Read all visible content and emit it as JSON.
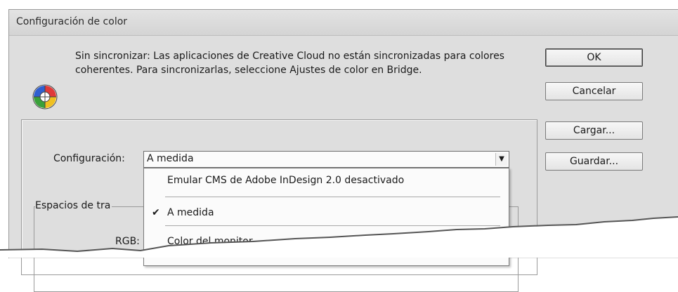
{
  "dialog": {
    "title": "Configuración de color",
    "sync_message": "Sin sincronizar: Las aplicaciones de Creative Cloud no están sincronizadas para colores coherentes. Para sincronizarlas, seleccione Ajustes de color en Bridge.",
    "sync_icon": "color-wheel-icon"
  },
  "buttons": {
    "ok": "OK",
    "cancel": "Cancelar",
    "load": "Cargar...",
    "save": "Guardar..."
  },
  "settings": {
    "label": "Configuración:",
    "selected": "A medida",
    "options": [
      {
        "label": "Emular CMS de Adobe InDesign 2.0 desactivado",
        "checked": false
      },
      {
        "label": "A medida",
        "checked": true
      },
      {
        "label": "Color del monitor",
        "checked": false
      }
    ],
    "check_mark": "✔"
  },
  "workspaces": {
    "label": "Espacios de tra",
    "rgb_label": "RGB:"
  },
  "colors": {
    "dialog_bg": "#dedede",
    "icon_red": "#e03a3a",
    "icon_green": "#3aa03a",
    "icon_blue": "#2f5fd0",
    "icon_yellow": "#f0c020"
  }
}
